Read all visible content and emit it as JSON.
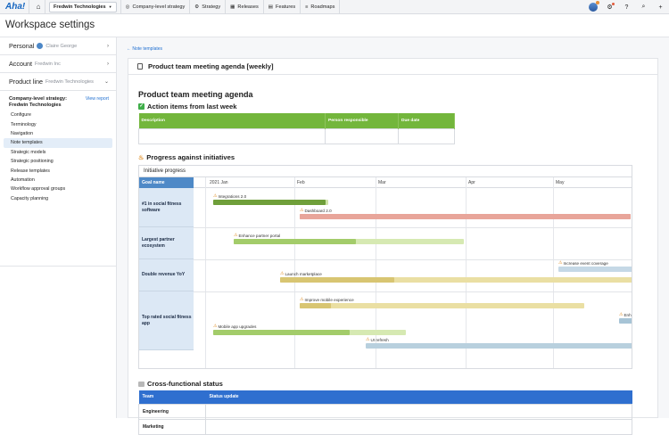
{
  "topbar": {
    "logo": "Aha!",
    "workspace": "Fredwin Technologies",
    "nav": [
      {
        "label": "Company-level strategy",
        "icon": "target-icon"
      },
      {
        "label": "Strategy",
        "icon": "gear-icon"
      },
      {
        "label": "Releases",
        "icon": "calendar-icon"
      },
      {
        "label": "Features",
        "icon": "list-icon"
      },
      {
        "label": "Roadmaps",
        "icon": "roadmap-icon"
      }
    ]
  },
  "page_title": "Workspace settings",
  "sidebar": {
    "personal": {
      "label": "Personal",
      "sub": "Claire George"
    },
    "account": {
      "label": "Account",
      "sub": "Fredwin Inc"
    },
    "product_line": {
      "label": "Product line",
      "sub": "Fredwin Technologies"
    },
    "section_title": "Company-level strategy: Fredwin Technologies",
    "view_report": "View report",
    "items": [
      "Configure",
      "Terminology",
      "Navigation",
      "Note templates",
      "Strategic models",
      "Strategic positioning",
      "Release templates",
      "Automation",
      "Workflow approval groups",
      "Capacity planning"
    ],
    "active_index": 3
  },
  "main": {
    "back_link": "← Note templates",
    "doc_title": "Product team meeting agenda [weekly]",
    "heading": "Product team meeting agenda",
    "action_items": {
      "title": "Action items from last week",
      "columns": [
        "Description",
        "Person responsible",
        "Due date"
      ]
    },
    "progress": {
      "title": "Progress against initiatives",
      "panel_title": "Initiative progress",
      "goal_header": "Goal name",
      "months": [
        "2021 Jan",
        "Feb",
        "Mar",
        "Apr",
        "May"
      ],
      "goals": [
        "#1 in social fitness software",
        "Largest partner ecosystem",
        "Double revenue YoY",
        "Top rated social fitness app"
      ],
      "initiatives": [
        {
          "name": "Integrations 2.0",
          "progress": 0.98
        },
        {
          "name": "Dashboard 2.0",
          "progress": 1.0
        },
        {
          "name": "Enhance partner portal",
          "progress": 0.53
        },
        {
          "name": "Increase event coverage",
          "progress": 0.0
        },
        {
          "name": "Launch marketplace",
          "progress": 0.32
        },
        {
          "name": "Improve mobile experience",
          "progress": 0.11
        },
        {
          "name": "Enh",
          "progress": 0.0
        },
        {
          "name": "Mobile app upgrades",
          "progress": 0.71
        },
        {
          "name": "UI refresh",
          "progress": 0.0
        }
      ]
    },
    "cross_functional": {
      "title": "Cross-functional status",
      "columns": [
        "Team",
        "Status update"
      ],
      "rows": [
        "Engineering",
        "Marketing"
      ]
    }
  },
  "colors": {
    "brand": "#1565c0",
    "green_header": "#73b63c",
    "blue_header": "#2f6fcf"
  }
}
